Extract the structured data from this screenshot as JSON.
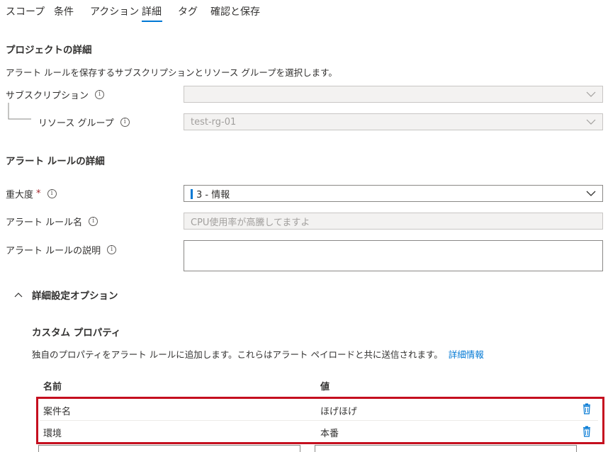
{
  "tabs": [
    {
      "label": "スコープ"
    },
    {
      "label": "条件"
    },
    {
      "label": "アクション"
    },
    {
      "label": "詳細"
    },
    {
      "label": "タグ"
    },
    {
      "label": "確認と保存"
    }
  ],
  "active_tab": "詳細",
  "project": {
    "title": "プロジェクトの詳細",
    "description": "アラート ルールを保存するサブスクリプションとリソース グループを選択します。",
    "subscription_label": "サブスクリプション",
    "subscription_value": "",
    "resource_group_label": "リソース グループ",
    "resource_group_value": "test-rg-01"
  },
  "rule": {
    "title": "アラート ルールの詳細",
    "severity_label": "重大度",
    "severity_required": "*",
    "severity_value": "3 - 情報",
    "severity_color": "#0078d4",
    "name_label": "アラート ルール名",
    "name_value": "CPU使用率が高騰してますよ",
    "description_label": "アラート ルールの説明",
    "description_value": ""
  },
  "advanced": {
    "toggle_label": "詳細設定オプション",
    "custom_title": "カスタム プロパティ",
    "custom_description": "独自のプロパティをアラート ルールに追加します。これらはアラート ペイロードと共に送信されます。",
    "learn_more": "詳細情報",
    "columns": {
      "name": "名前",
      "value": "値"
    },
    "rows": [
      {
        "name": "案件名",
        "value": "ほげほげ"
      },
      {
        "name": "環境",
        "value": "本番"
      }
    ]
  },
  "colors": {
    "accent": "#0078d4",
    "highlight_border": "#c50f1f",
    "trash_icon": "#0078d4"
  },
  "icons": {
    "info": "info-icon",
    "chevron_down": "chevron-down-icon",
    "chevron_up": "chevron-up-icon",
    "trash": "trash-icon"
  }
}
